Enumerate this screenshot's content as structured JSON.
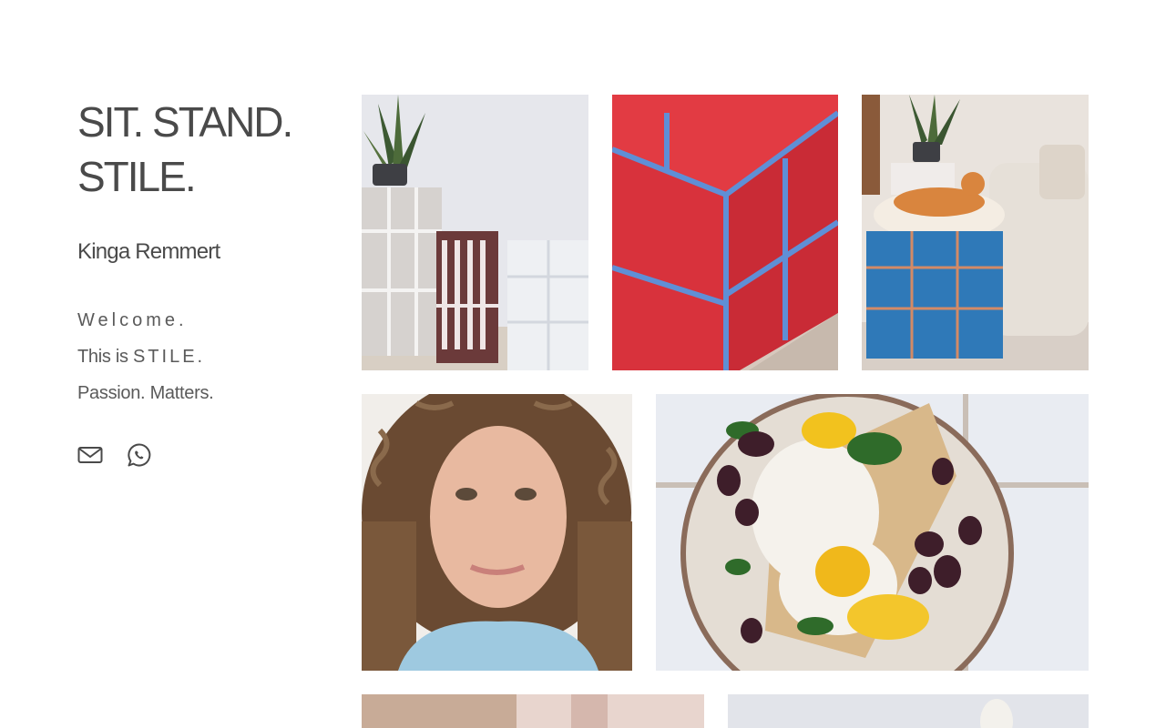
{
  "site": {
    "title_line1": "SIT. STAND.",
    "title_line2": "STILE.",
    "author": "Kinga Remmert"
  },
  "tagline": {
    "welcome": "Welcome.",
    "this_is": "This is",
    "brand": "STILE",
    "period": ".",
    "slogan": "Passion. Matters."
  },
  "social": [
    {
      "name": "email",
      "icon": "envelope-icon"
    },
    {
      "name": "whatsapp",
      "icon": "whatsapp-icon"
    }
  ],
  "gallery": [
    {
      "subject": "tiled side tables with snake plant",
      "icon": "photo"
    },
    {
      "subject": "red tiled cube with blue grout",
      "icon": "photo"
    },
    {
      "subject": "blue tiled cube with ginger cat",
      "icon": "photo"
    },
    {
      "subject": "portrait of curly-haired woman",
      "icon": "photo"
    },
    {
      "subject": "eggs on toast with olives",
      "icon": "photo"
    },
    {
      "subject": "partial photo",
      "icon": "photo"
    },
    {
      "subject": "partial photo",
      "icon": "photo"
    }
  ],
  "colors": {
    "text": "#4a4a4a",
    "background": "#ffffff"
  }
}
